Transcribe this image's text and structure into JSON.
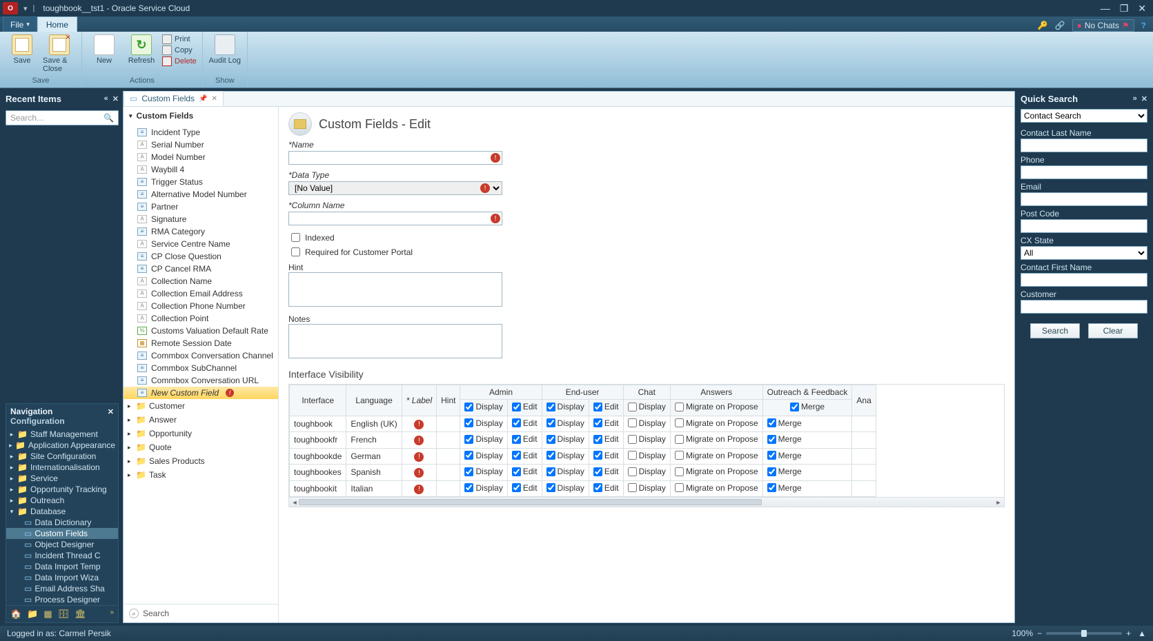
{
  "window": {
    "title": "toughbook__tst1  -  Oracle Service Cloud"
  },
  "menubar": {
    "file": "File",
    "home": "Home",
    "no_chats": "No Chats"
  },
  "ribbon": {
    "save": "Save",
    "save_close": "Save & Close",
    "new": "New",
    "refresh": "Refresh",
    "print": "Print",
    "copy": "Copy",
    "delete": "Delete",
    "audit_log": "Audit Log",
    "group_save": "Save",
    "group_actions": "Actions",
    "group_show": "Show"
  },
  "recent": {
    "title": "Recent Items",
    "placeholder": "Search..."
  },
  "navigation": {
    "title": "Navigation",
    "subtitle": "Configuration",
    "nodes": [
      {
        "label": "Staff Management"
      },
      {
        "label": "Application Appearance"
      },
      {
        "label": "Site Configuration"
      },
      {
        "label": "Internationalisation"
      },
      {
        "label": "Service"
      },
      {
        "label": "Opportunity Tracking"
      },
      {
        "label": "Outreach"
      },
      {
        "label": "Database",
        "expanded": true
      }
    ],
    "db_children": [
      {
        "label": "Data Dictionary"
      },
      {
        "label": "Custom Fields",
        "selected": true
      },
      {
        "label": "Object Designer"
      },
      {
        "label": "Incident Thread C"
      },
      {
        "label": "Data Import Temp"
      },
      {
        "label": "Data Import Wiza"
      },
      {
        "label": "Email Address Sha"
      },
      {
        "label": "Process Designer"
      }
    ]
  },
  "doc_tab": {
    "label": "Custom Fields"
  },
  "explorer": {
    "title": "Custom Fields",
    "fields": [
      {
        "ico": "m",
        "label": "Incident Type"
      },
      {
        "ico": "t",
        "label": "Serial Number"
      },
      {
        "ico": "t",
        "label": "Model Number"
      },
      {
        "ico": "t",
        "label": "Waybill 4"
      },
      {
        "ico": "m",
        "label": "Trigger Status"
      },
      {
        "ico": "m",
        "label": "Alternative Model Number"
      },
      {
        "ico": "m",
        "label": "Partner"
      },
      {
        "ico": "t",
        "label": "Signature"
      },
      {
        "ico": "m",
        "label": "RMA Category"
      },
      {
        "ico": "t",
        "label": "Service Centre Name"
      },
      {
        "ico": "m",
        "label": "CP Close Question"
      },
      {
        "ico": "m",
        "label": "CP Cancel RMA"
      },
      {
        "ico": "t",
        "label": "Collection Name"
      },
      {
        "ico": "t",
        "label": "Collection Email Address"
      },
      {
        "ico": "t",
        "label": "Collection Phone Number"
      },
      {
        "ico": "t",
        "label": "Collection Point"
      },
      {
        "ico": "c",
        "label": "Customs Valuation Default Rate"
      },
      {
        "ico": "d",
        "label": "Remote Session Date"
      },
      {
        "ico": "m",
        "label": "Commbox Conversation Channel"
      },
      {
        "ico": "m",
        "label": "Commbox SubChannel"
      },
      {
        "ico": "m",
        "label": "Commbox Conversation URL"
      }
    ],
    "new_field": "New Custom Field",
    "categories": [
      {
        "label": "Customer"
      },
      {
        "label": "Answer"
      },
      {
        "label": "Opportunity"
      },
      {
        "label": "Quote"
      },
      {
        "label": "Sales Products"
      },
      {
        "label": "Task"
      }
    ],
    "search": "Search"
  },
  "editor": {
    "title": "Custom Fields - Edit",
    "name_label": "Name",
    "data_type_label": "Data Type",
    "data_type_value": "[No Value]",
    "column_name_label": "Column Name",
    "indexed": "Indexed",
    "required_cp": "Required for Customer Portal",
    "hint": "Hint",
    "notes": "Notes",
    "iv_title": "Interface Visibility",
    "iv_headers": {
      "interface": "Interface",
      "language": "Language",
      "label": "* Label",
      "hint": "Hint",
      "admin": "Admin",
      "end_user": "End-user",
      "chat": "Chat",
      "answers": "Answers",
      "outreach": "Outreach & Feedback",
      "ana": "Ana"
    },
    "iv_sub": {
      "display": "Display",
      "edit": "Edit",
      "migrate": "Migrate on Propose",
      "merge": "Merge"
    },
    "iv_rows": [
      {
        "iface": "toughbook",
        "lang": "English (UK)"
      },
      {
        "iface": "toughbookfr",
        "lang": "French"
      },
      {
        "iface": "toughbookde",
        "lang": "German"
      },
      {
        "iface": "toughbookes",
        "lang": "Spanish"
      },
      {
        "iface": "toughbookit",
        "lang": "Italian"
      }
    ]
  },
  "quick_search": {
    "title": "Quick Search",
    "combo": "Contact Search",
    "fields": [
      {
        "key": "last",
        "label": "Contact Last Name",
        "type": "text"
      },
      {
        "key": "phone",
        "label": "Phone",
        "type": "text"
      },
      {
        "key": "email",
        "label": "Email",
        "type": "text"
      },
      {
        "key": "post",
        "label": "Post Code",
        "type": "text"
      },
      {
        "key": "cx",
        "label": "CX State",
        "type": "select",
        "value": "All"
      },
      {
        "key": "first",
        "label": "Contact First Name",
        "type": "text"
      },
      {
        "key": "cust",
        "label": "Customer",
        "type": "text"
      }
    ],
    "search_btn": "Search",
    "clear_btn": "Clear"
  },
  "status": {
    "logged_in": "Logged in as: Carmel Persik",
    "zoom": "100%"
  }
}
